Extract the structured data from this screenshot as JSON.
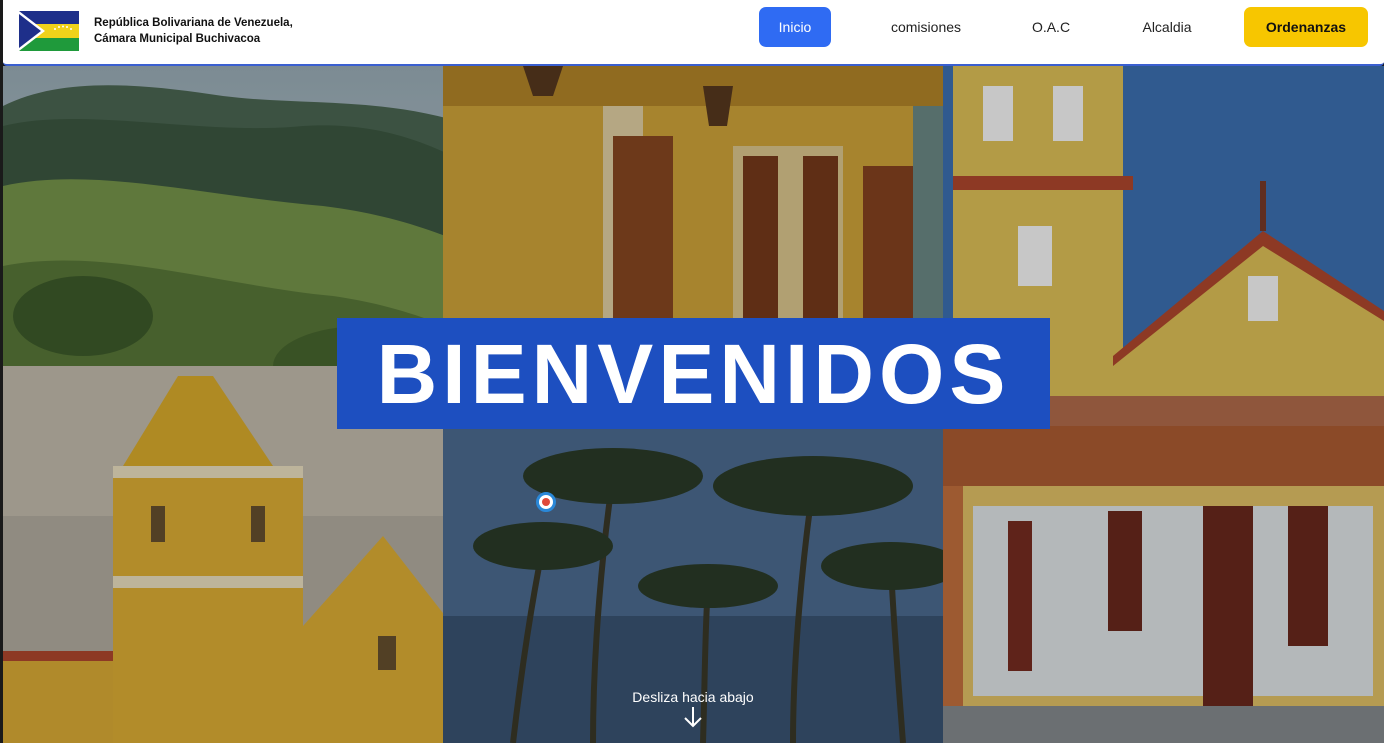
{
  "header": {
    "brand_line1": "República Bolivariana de Venezuela,",
    "brand_line2": "Cámara Municipal Buchivacoa",
    "logo_icon": "flag-logo-icon",
    "flag_colors": [
      "#1e2f8a",
      "#f1d21a",
      "#1f9a3b"
    ]
  },
  "nav": {
    "inicio": "Inicio",
    "comisiones": "comisiones",
    "oac": "O.A.C",
    "alcaldia": "Alcaldia",
    "ordenanzas": "Ordenanzas"
  },
  "hero": {
    "title": "BIENVENIDOS",
    "scroll_hint": "Desliza hacia abajo",
    "scroll_icon": "arrow-down-icon"
  },
  "colors": {
    "accent": "#2f6bf3",
    "title_bg": "#1d4fc0",
    "cta": "#f7c600"
  }
}
